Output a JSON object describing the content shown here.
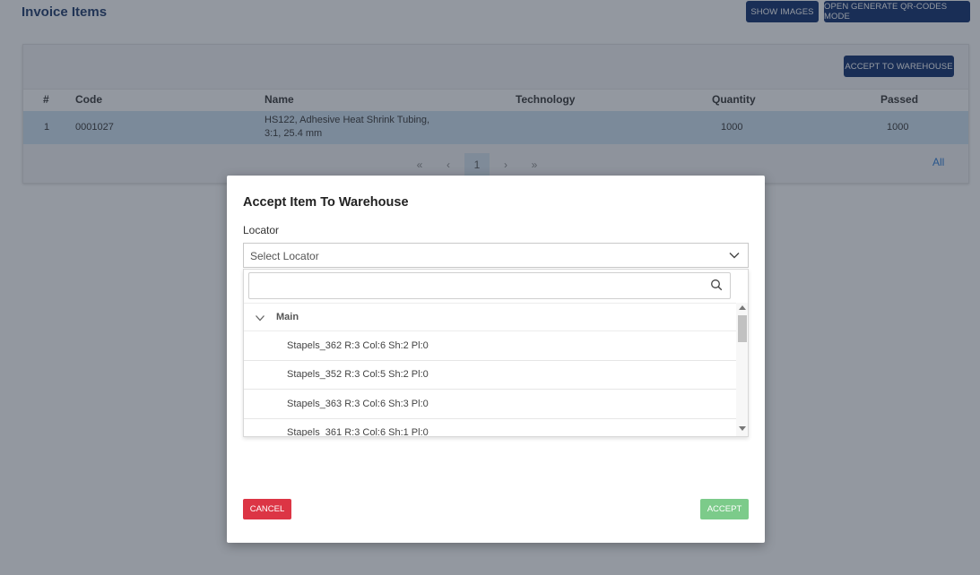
{
  "page": {
    "title": "Invoice Items",
    "show_images_label": "SHOW IMAGES",
    "qr_mode_label": "OPEN GENERATE QR-CODES MODE"
  },
  "table": {
    "accept_warehouse_label": "ACCEPT TO WAREHOUSE",
    "columns": [
      "#",
      "Code",
      "Name",
      "Technology",
      "Quantity",
      "Passed"
    ],
    "rows": [
      {
        "num": "1",
        "code": "0001027",
        "name_line1": "HS122, Adhesive Heat Shrink Tubing,",
        "name_line2": "3:1, 25.4 mm",
        "technology": "",
        "quantity": "1000",
        "passed": "1000"
      }
    ],
    "pagination": {
      "first": "«",
      "prev": "‹",
      "current": "1",
      "next": "›",
      "last": "»",
      "all": "All"
    }
  },
  "modal": {
    "title": "Accept Item To Warehouse",
    "locator_label": "Locator",
    "select_placeholder": "Select Locator",
    "search_placeholder": "",
    "group": "Main",
    "items": [
      "Stapels_362 R:3 Col:6 Sh:2 Pl:0",
      "Stapels_352 R:3 Col:5 Sh:2 Pl:0",
      "Stapels_363 R:3 Col:6 Sh:3 Pl:0",
      "Stapels_361 R:3 Col:6 Sh:1 Pl:0"
    ],
    "cancel_label": "CANCEL",
    "accept_label": "ACCEPT"
  },
  "colors": {
    "navy": "#0a2a6b",
    "cancel": "#dc3545",
    "accept": "#7ccb8a",
    "row_selected": "#cfe2f3"
  }
}
